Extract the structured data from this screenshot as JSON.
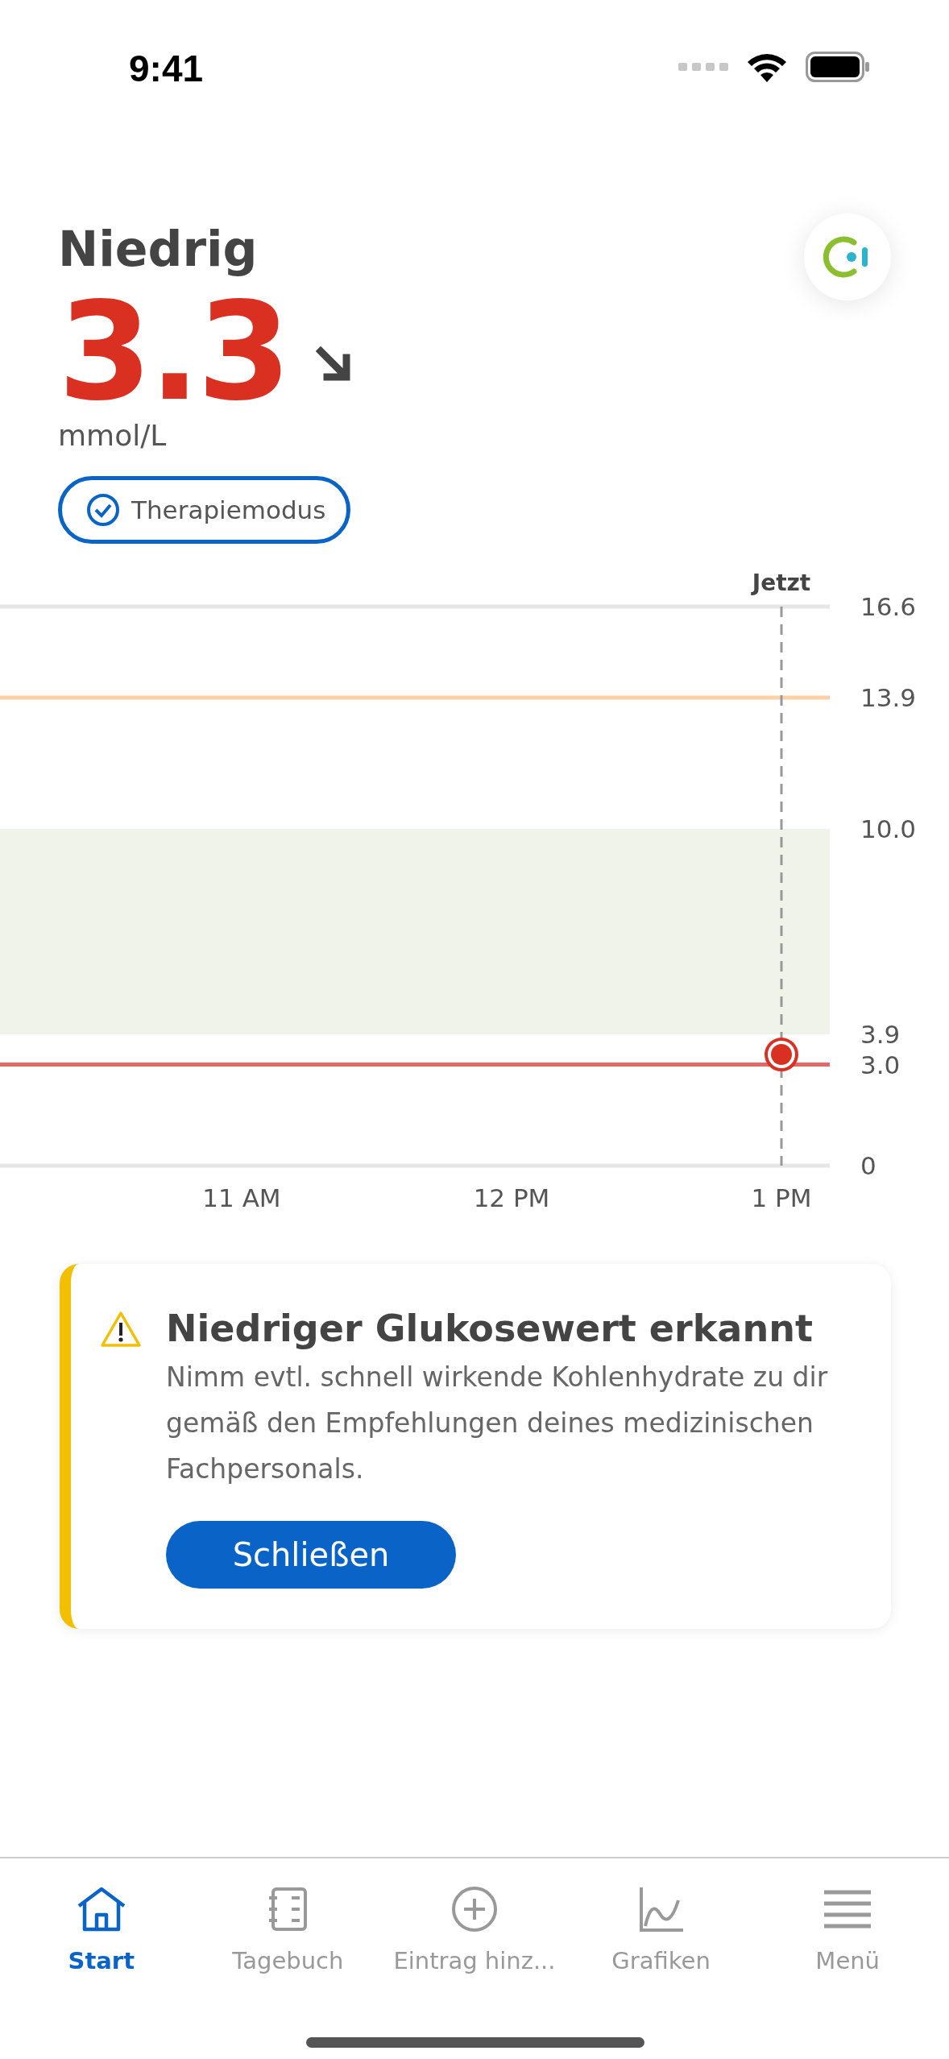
{
  "status_bar": {
    "time": "9:41"
  },
  "reading": {
    "label": "Niedrig",
    "value": "3.3",
    "unit": "mmol/L",
    "color": "#d93021"
  },
  "mode_badge": {
    "label": "Therapiemodus",
    "checked": true
  },
  "chart": {
    "chart_data": {
      "type": "scatter",
      "categories": [
        "11 AM",
        "12 PM",
        "1 PM"
      ],
      "values": [
        null,
        null,
        3.3
      ],
      "ylim": [
        0,
        16.6
      ],
      "yticks": [
        {
          "value": 0,
          "label": "0"
        },
        {
          "value": 3.0,
          "label": "3.0"
        },
        {
          "value": 3.9,
          "label": "3.9"
        },
        {
          "value": 10.0,
          "label": "10.0"
        },
        {
          "value": 13.9,
          "label": "13.9"
        },
        {
          "value": 16.6,
          "label": "16.6"
        }
      ],
      "bands": [
        {
          "axis": "y",
          "from": 3.9,
          "to": 10.0,
          "color": "#f0f3ea"
        }
      ],
      "ref_lines": [
        {
          "axis": "y",
          "value": 13.9,
          "color": "#fdd0a8"
        },
        {
          "axis": "y",
          "value": 3.0,
          "color": "#e06a6a"
        },
        {
          "axis": "x",
          "value": "1 PM",
          "label": "Jetzt",
          "color": "#999999"
        }
      ]
    }
  },
  "alert": {
    "title": "Niedriger Glukosewert erkannt",
    "message": "Nimm evtl. schnell wirkende Kohlenhydrate zu dir gemäß den Empfehlungen deines medizinischen Fachpersonals.",
    "button": "Schließen"
  },
  "tabs": [
    {
      "label": "Start",
      "selected": true
    },
    {
      "label": "Tagebuch",
      "selected": false
    },
    {
      "label": "Eintrag hinz...",
      "selected": false
    },
    {
      "label": "Grafiken",
      "selected": false
    },
    {
      "label": "Menü",
      "selected": false
    }
  ]
}
